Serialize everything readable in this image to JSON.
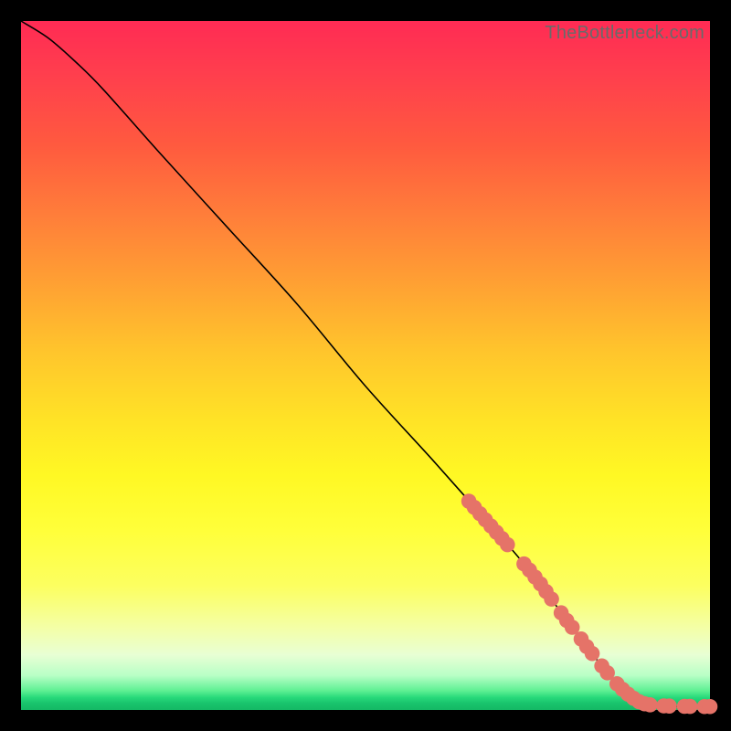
{
  "attribution": "TheBottleneck.com",
  "chart_data": {
    "type": "line",
    "title": "",
    "xlabel": "",
    "ylabel": "",
    "xlim": [
      0,
      100
    ],
    "ylim": [
      0,
      100
    ],
    "curve": {
      "name": "bottleneck-curve",
      "color": "#000000",
      "points": [
        {
          "x": 0,
          "y": 100
        },
        {
          "x": 4,
          "y": 97.5
        },
        {
          "x": 8,
          "y": 94
        },
        {
          "x": 12,
          "y": 90
        },
        {
          "x": 20,
          "y": 81
        },
        {
          "x": 30,
          "y": 70
        },
        {
          "x": 40,
          "y": 59
        },
        {
          "x": 50,
          "y": 47
        },
        {
          "x": 60,
          "y": 36
        },
        {
          "x": 68,
          "y": 27
        },
        {
          "x": 74,
          "y": 20
        },
        {
          "x": 80,
          "y": 12
        },
        {
          "x": 85,
          "y": 5.5
        },
        {
          "x": 88,
          "y": 2.2
        },
        {
          "x": 90,
          "y": 1.0
        },
        {
          "x": 93,
          "y": 0.6
        },
        {
          "x": 96,
          "y": 0.5
        },
        {
          "x": 100,
          "y": 0.5
        }
      ]
    },
    "markers": {
      "name": "highlighted-range",
      "color": "#e57368",
      "radius_pct": 1.1,
      "points": [
        {
          "x": 65.0,
          "y": 30.3
        },
        {
          "x": 65.8,
          "y": 29.4
        },
        {
          "x": 66.6,
          "y": 28.5
        },
        {
          "x": 67.4,
          "y": 27.6
        },
        {
          "x": 68.2,
          "y": 26.7
        },
        {
          "x": 69.0,
          "y": 25.8
        },
        {
          "x": 69.8,
          "y": 24.9
        },
        {
          "x": 70.6,
          "y": 24.0
        },
        {
          "x": 73.0,
          "y": 21.2
        },
        {
          "x": 73.8,
          "y": 20.3
        },
        {
          "x": 74.6,
          "y": 19.3
        },
        {
          "x": 75.4,
          "y": 18.3
        },
        {
          "x": 76.2,
          "y": 17.2
        },
        {
          "x": 77.0,
          "y": 16.1
        },
        {
          "x": 78.4,
          "y": 14.1
        },
        {
          "x": 79.2,
          "y": 13.0
        },
        {
          "x": 80.0,
          "y": 12.0
        },
        {
          "x": 81.3,
          "y": 10.3
        },
        {
          "x": 82.1,
          "y": 9.2
        },
        {
          "x": 82.9,
          "y": 8.2
        },
        {
          "x": 84.3,
          "y": 6.4
        },
        {
          "x": 85.1,
          "y": 5.4
        },
        {
          "x": 86.5,
          "y": 3.8
        },
        {
          "x": 87.3,
          "y": 3.0
        },
        {
          "x": 88.1,
          "y": 2.3
        },
        {
          "x": 88.9,
          "y": 1.7
        },
        {
          "x": 89.7,
          "y": 1.2
        },
        {
          "x": 90.5,
          "y": 0.9
        },
        {
          "x": 91.3,
          "y": 0.75
        },
        {
          "x": 93.3,
          "y": 0.6
        },
        {
          "x": 94.1,
          "y": 0.57
        },
        {
          "x": 96.3,
          "y": 0.53
        },
        {
          "x": 97.1,
          "y": 0.52
        },
        {
          "x": 99.2,
          "y": 0.5
        },
        {
          "x": 100.0,
          "y": 0.5
        }
      ]
    }
  }
}
